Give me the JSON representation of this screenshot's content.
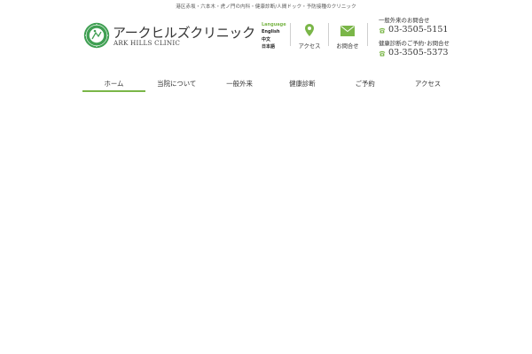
{
  "topnote": "港区赤坂・六本木・虎ノ門の内科・健康診断/人間ドック・予防接種のクリニック",
  "brand": {
    "name_jp": "アークヒルズクリニック",
    "name_en": "ARK HILLS CLINIC"
  },
  "language": {
    "heading": "Language",
    "items": [
      "English",
      "中文",
      "日本語"
    ]
  },
  "header_buttons": {
    "access_label": "アクセス",
    "inquiry_label": "お問合せ"
  },
  "contacts": [
    {
      "label": "一般外来のお問合せ",
      "tel": "03-3505-5151"
    },
    {
      "label": "健康診断のご予約･お問合せ",
      "tel": "03-3505-5373"
    }
  ],
  "nav": {
    "items": [
      {
        "label": "ホーム",
        "active": true
      },
      {
        "label": "当院について"
      },
      {
        "label": "一般外来"
      },
      {
        "label": "健康診断"
      },
      {
        "label": "ご予約"
      },
      {
        "label": "アクセス"
      }
    ]
  },
  "colors": {
    "accent_green": "#7ab648",
    "text": "#333333"
  }
}
